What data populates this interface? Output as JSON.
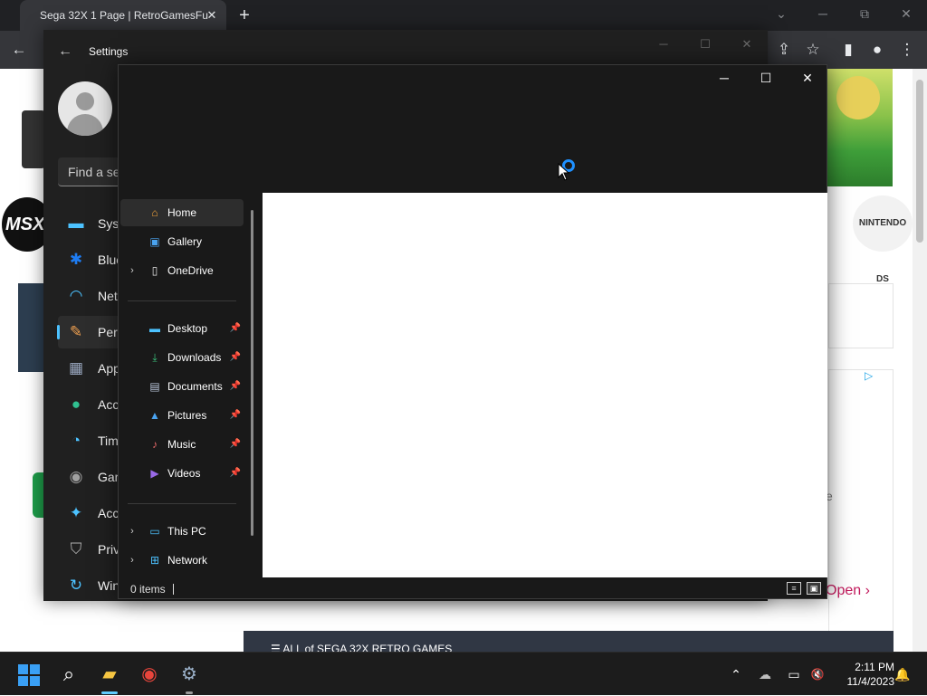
{
  "browser": {
    "tab_title": "Sega 32X 1 Page | RetroGamesFu",
    "tab_close": "✕",
    "new_tab": "+",
    "window_controls": {
      "minimize": "─",
      "restore": "⧉",
      "close": "✕",
      "dropdown": "⌄"
    },
    "toolbar": {
      "back": "←",
      "share": "⇪",
      "star": "☆",
      "sidepanel": "▮",
      "profile": "●",
      "menu": "⋮"
    },
    "page": {
      "ds_badge": "NINTENDO DS",
      "msx_badge": "MSX",
      "ad_play": "▷",
      "ad_fragment": "e",
      "open_link": "Open",
      "open_chevron": "›",
      "bottom_banner": "☰ ALL of SEGA 32X RETRO GAMES"
    }
  },
  "settings": {
    "title": "Settings",
    "back": "←",
    "window_controls": {
      "minimize": "─",
      "maximize": "☐",
      "close": "✕"
    },
    "search_placeholder": "Find a se",
    "nav": [
      {
        "label": "Syst",
        "icon": "▬",
        "color": "#4cc2ff"
      },
      {
        "label": "Blue",
        "icon": "✱",
        "color": "#1e7cf2"
      },
      {
        "label": "Net",
        "icon": "◠",
        "color": "#4cc2ff"
      },
      {
        "label": "Pers",
        "icon": "✎",
        "color": "#f0a050",
        "active": true
      },
      {
        "label": "App",
        "icon": "▦",
        "color": "#9aa8c0"
      },
      {
        "label": "Acc",
        "icon": "●",
        "color": "#30c090"
      },
      {
        "label": "Tim",
        "icon": "◔",
        "color": "#4cc2ff"
      },
      {
        "label": "Gar",
        "icon": "◉",
        "color": "#a0a0a0"
      },
      {
        "label": "Acc",
        "icon": "✦",
        "color": "#4cc2ff"
      },
      {
        "label": "Priv",
        "icon": "⛉",
        "color": "#b0b0b0"
      },
      {
        "label": "Win",
        "icon": "↻",
        "color": "#4cc2ff"
      }
    ]
  },
  "explorer": {
    "window_controls": {
      "minimize": "─",
      "maximize": "☐",
      "close": "✕"
    },
    "nav_items": [
      {
        "label": "Home",
        "icon": "⌂",
        "color": "#f2a33a",
        "selected": true,
        "chevron": "",
        "pin": ""
      },
      {
        "label": "Gallery",
        "icon": "▣",
        "color": "#4aa3f0",
        "chevron": "",
        "pin": ""
      },
      {
        "label": "OneDrive",
        "icon": "▯",
        "color": "#e8e8e8",
        "chevron": "›",
        "pin": ""
      },
      {
        "label": "Desktop",
        "icon": "▬",
        "color": "#4cc2ff",
        "chevron": "",
        "pin": "📌"
      },
      {
        "label": "Downloads",
        "icon": "⤓",
        "color": "#3ac07a",
        "chevron": "",
        "pin": "📌"
      },
      {
        "label": "Documents",
        "icon": "▤",
        "color": "#b8c4d8",
        "chevron": "",
        "pin": "📌"
      },
      {
        "label": "Pictures",
        "icon": "▲",
        "color": "#4aa3f0",
        "chevron": "",
        "pin": "📌"
      },
      {
        "label": "Music",
        "icon": "♪",
        "color": "#e86a6a",
        "chevron": "",
        "pin": "📌"
      },
      {
        "label": "Videos",
        "icon": "▶",
        "color": "#9a6ae8",
        "chevron": "",
        "pin": "📌"
      },
      {
        "label": "This PC",
        "icon": "▭",
        "color": "#4cc2ff",
        "chevron": "›",
        "pin": ""
      },
      {
        "label": "Network",
        "icon": "⊞",
        "color": "#4cc2ff",
        "chevron": "›",
        "pin": ""
      }
    ],
    "status": {
      "count": "0 items",
      "view_details": "≡",
      "view_tiles": "▣"
    }
  },
  "taskbar": {
    "search": "⌕",
    "explorer": "▰",
    "chrome": "◉",
    "settings": "⚙",
    "tray": {
      "chevron": "⌃",
      "onedrive": "☁",
      "network": "▭",
      "volume": "🔇",
      "notifications": "🔔"
    },
    "time": "2:11 PM",
    "date": "11/4/2023"
  }
}
